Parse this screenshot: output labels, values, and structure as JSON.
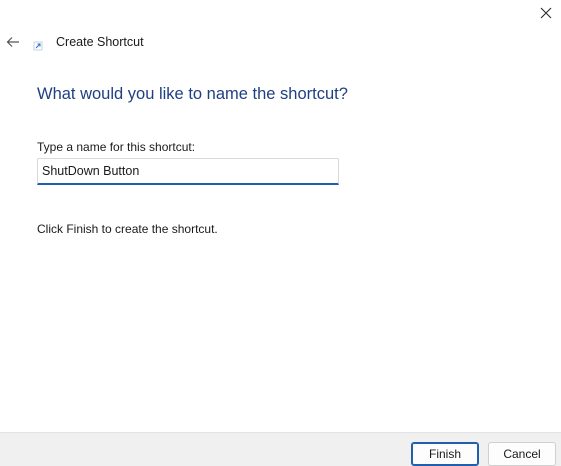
{
  "window": {
    "title": "Create Shortcut"
  },
  "page": {
    "heading": "What would you like to name the shortcut?",
    "field_label": "Type a name for this shortcut:",
    "field_value": "ShutDown Button",
    "hint": "Click Finish to create the shortcut."
  },
  "footer": {
    "finish_label": "Finish",
    "cancel_label": "Cancel"
  },
  "icons": {
    "back": "back-arrow-icon",
    "close": "close-icon",
    "wizard": "shortcut-wizard-icon"
  },
  "colors": {
    "heading": "#1f3f82",
    "accent": "#1f5fae",
    "footer_bg": "#f0f0f0"
  }
}
